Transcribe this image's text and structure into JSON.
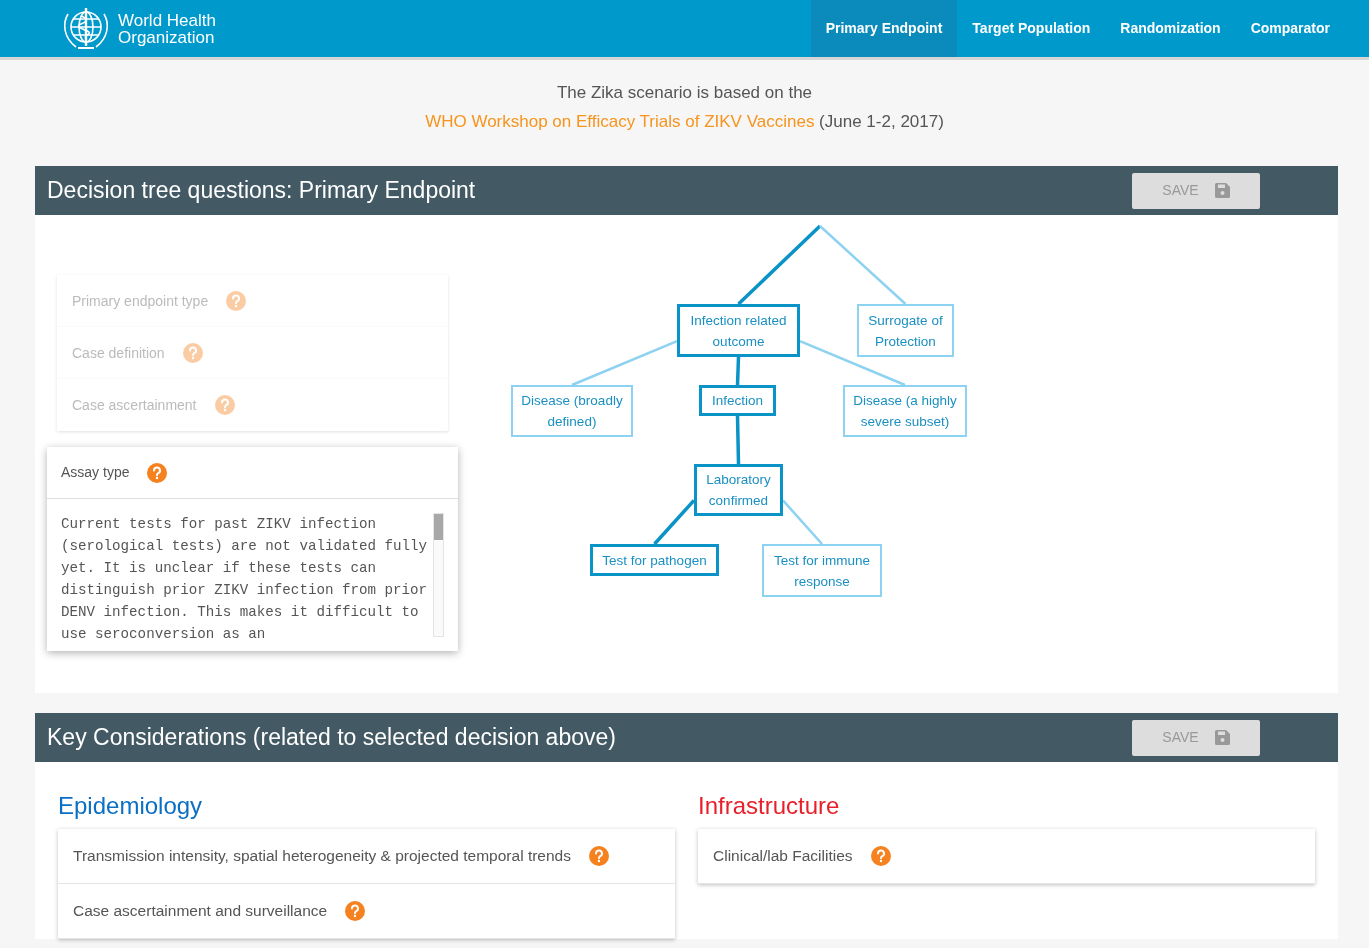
{
  "navbar": {
    "brand": "World Health Organization",
    "tabs": [
      {
        "label": "Primary Endpoint",
        "selected": true
      },
      {
        "label": "Target Population",
        "selected": false
      },
      {
        "label": "Randomization",
        "selected": false
      },
      {
        "label": "Comparator",
        "selected": false
      }
    ]
  },
  "intro": {
    "text_before": "The Zika scenario is based on the",
    "link": "WHO Workshop on Efficacy Trials of ZIKV Vaccines",
    "text_after": "(June 1-2, 2017)"
  },
  "decision_panel": {
    "title": "Decision tree questions: Primary Endpoint",
    "save_label": "SAVE",
    "questions": [
      {
        "label": "Primary endpoint type",
        "selected": false
      },
      {
        "label": "Case definition",
        "selected": false
      },
      {
        "label": "Case ascertainment",
        "selected": false
      },
      {
        "label": "Assay type",
        "selected": true,
        "text": "Current tests for past ZIKV infection (serological tests) are not validated fully yet. It is unclear if these tests can distinguish prior ZIKV infection from prior DENV infection. This makes it difficult to use seroconversion as an"
      }
    ],
    "tree": [
      {
        "label": "Infection related outcome",
        "selected": true,
        "children": [
          {
            "label": "Disease (broadly defined)",
            "selected": false
          },
          {
            "label": "Infection",
            "selected": true,
            "children": [
              {
                "label": "Laboratory confirmed",
                "selected": true,
                "children": [
                  {
                    "label": "Test for pathogen",
                    "selected": true
                  },
                  {
                    "label": "Test for immune response",
                    "selected": false
                  }
                ]
              }
            ]
          },
          {
            "label": "Disease (a highly severe subset)",
            "selected": false
          }
        ]
      },
      {
        "label": "Surrogate of Protection",
        "selected": false
      }
    ]
  },
  "considerations_panel": {
    "title": "Key Considerations (related to selected decision above)",
    "save_label": "SAVE",
    "categories": [
      {
        "title": "Epidemiology",
        "color": "#0b6fc4",
        "items": [
          "Transmission intensity, spatial heterogeneity & projected temporal trends",
          "Case ascertainment and surveillance"
        ]
      },
      {
        "title": "Infrastructure",
        "color": "#e8202a",
        "items": [
          "Clinical/lab Facilities"
        ]
      }
    ]
  }
}
